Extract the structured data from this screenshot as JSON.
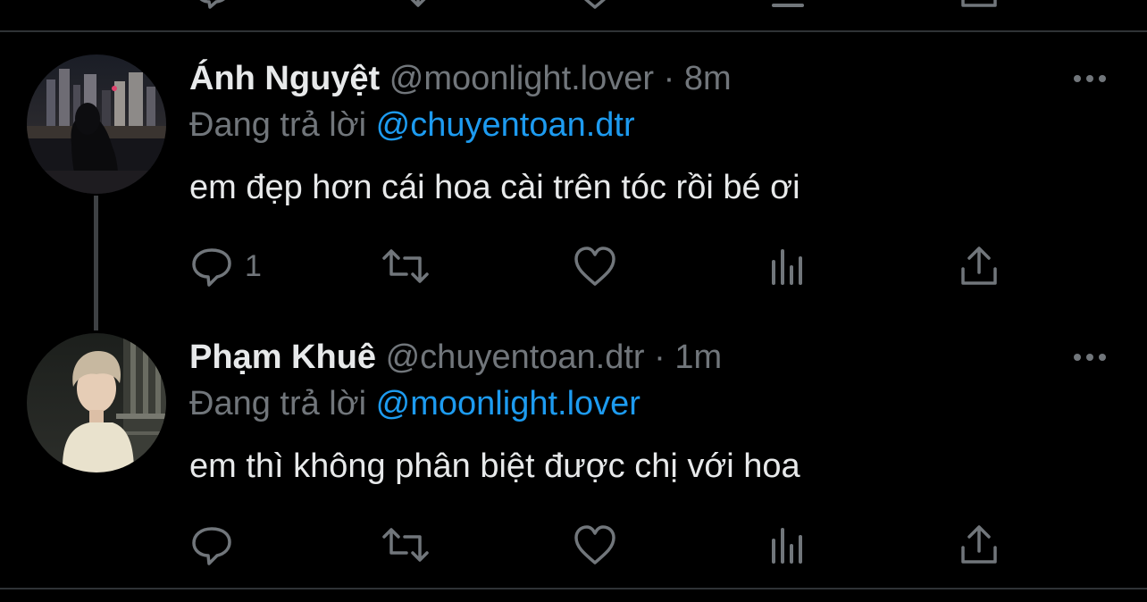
{
  "tweets": [
    {
      "display_name": "Ánh Nguyệt",
      "handle": "@moonlight.lover",
      "separator": "·",
      "time": "8m",
      "replying_prefix": "Đang trả lời",
      "replying_to": "@chuyentoan.dtr",
      "text": "em đẹp hơn cái hoa cài trên tóc rồi bé ơi",
      "reply_count": "1",
      "avatar": "night-city-skyline-photo"
    },
    {
      "display_name": "Phạm Khuê",
      "handle": "@chuyentoan.dtr",
      "separator": "·",
      "time": "1m",
      "replying_prefix": "Đang trả lời",
      "replying_to": "@moonlight.lover",
      "text": "em thì không phân biệt được chị với hoa",
      "reply_count": "",
      "avatar": "blond-person-night-photo"
    }
  ],
  "icons": {
    "reply": "reply-icon",
    "retweet": "retweet-icon",
    "like": "heart-icon",
    "views": "views-icon",
    "share": "share-icon",
    "more": "more-icon"
  },
  "colors": {
    "background": "#000000",
    "primary_text": "#e7e9ea",
    "secondary_text": "#71767b",
    "mention": "#1d9bf0",
    "divider": "#2f3336"
  }
}
